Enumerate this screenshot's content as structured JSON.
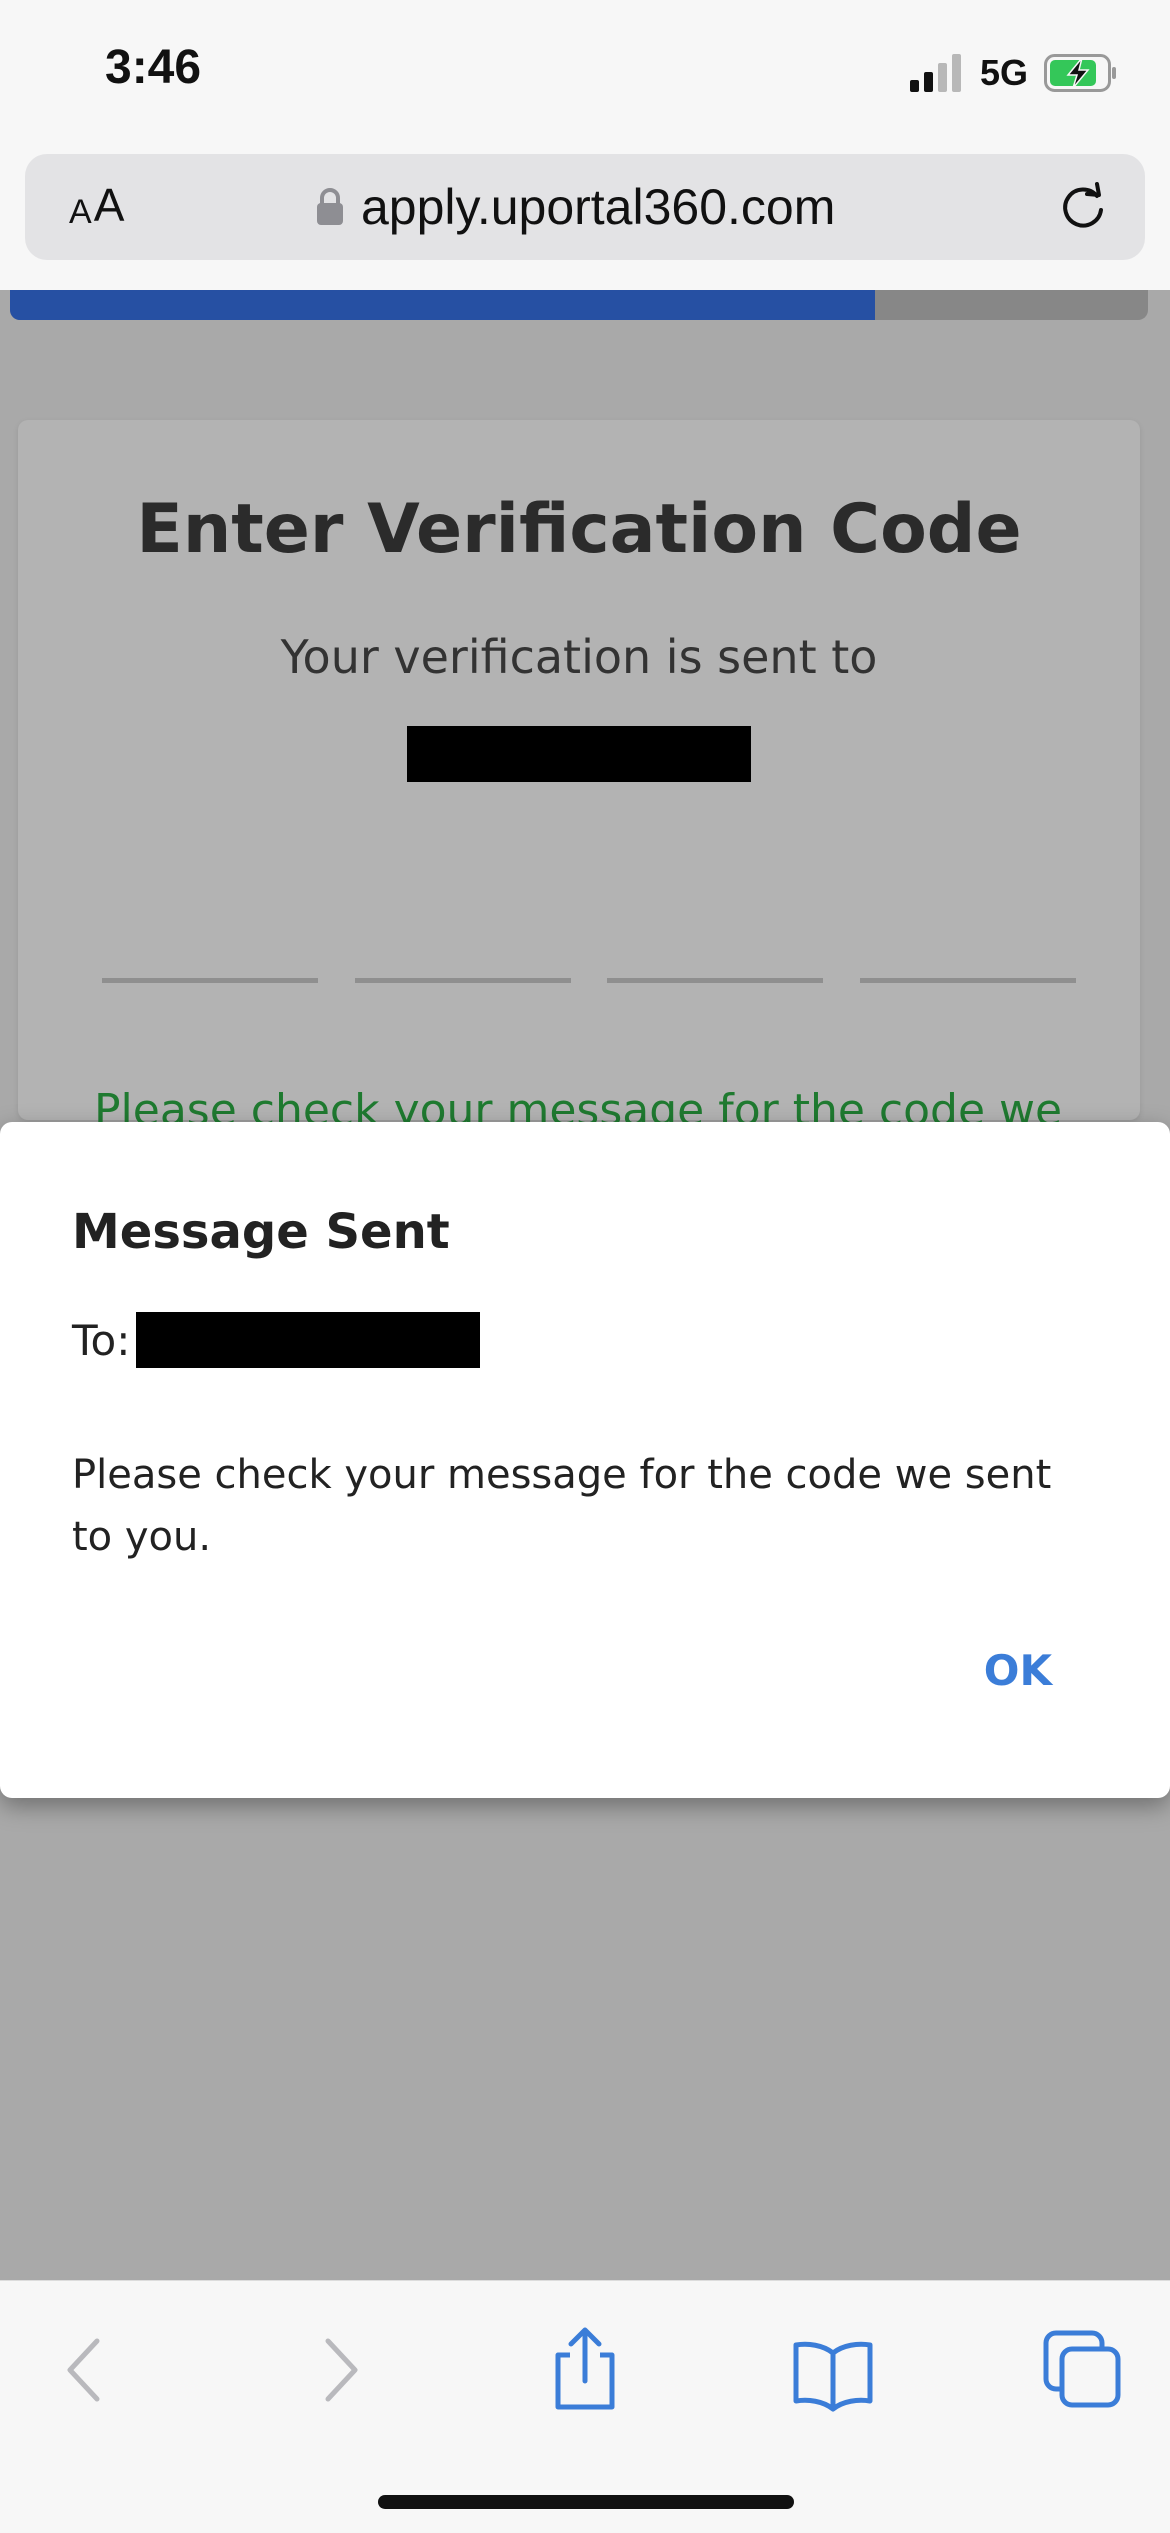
{
  "status_bar": {
    "time": "3:46",
    "network": "5G",
    "icons": [
      "signal-icon",
      "battery-charging-icon"
    ]
  },
  "browser": {
    "aa_small": "A",
    "aa_big": "A",
    "url": "apply.uportal360.com",
    "icons": [
      "lock-icon",
      "reload-icon"
    ]
  },
  "progress": {
    "percent": 76,
    "fill_color": "#2650a3"
  },
  "card": {
    "title": "Enter Verification Code",
    "subtitle": "Your verification is sent to",
    "code_slots": 4,
    "notice": "Please check your message for the code we"
  },
  "modal": {
    "title": "Message Sent",
    "to_label": "To:",
    "message": "Please check your message for the code we sent to you.",
    "ok_label": "OK",
    "ok_color": "#3b7dd8"
  },
  "toolbar": {
    "icons": [
      "back-icon",
      "forward-icon",
      "share-icon",
      "bookmarks-icon",
      "tabs-icon"
    ],
    "accent_color": "#3b7dd8"
  }
}
